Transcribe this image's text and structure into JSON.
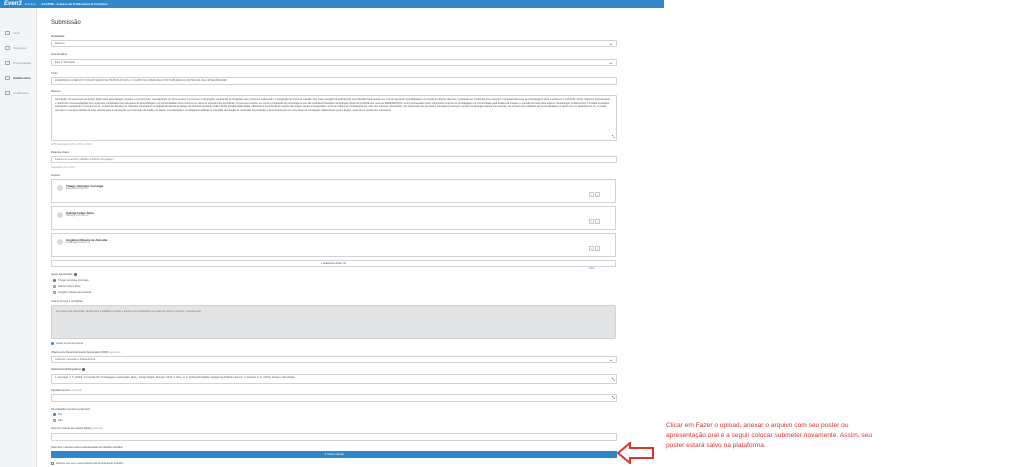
{
  "app": {
    "brand": "Even3",
    "brand_sub": "Eventos",
    "conference_title": "CLAPDE - Arquivo de Publicações & Coleções"
  },
  "sidebar": {
    "items": [
      {
        "label": "Início",
        "icon": "home-icon"
      },
      {
        "label": "Inscrições",
        "icon": "ticket-icon"
      },
      {
        "label": "Programação",
        "icon": "calendar-icon"
      },
      {
        "label": "Submissões",
        "icon": "document-icon",
        "active": true
      },
      {
        "label": "Certificados",
        "icon": "certificate-icon"
      }
    ]
  },
  "page": {
    "title": "Submissão"
  },
  "form": {
    "modality": {
      "label": "Modalidade",
      "value": "Resumo"
    },
    "thematic_area": {
      "label": "Área temática",
      "value": "Eixo 3: Educação"
    },
    "title": {
      "label": "Título",
      "value": "LIDERANÇA, EXERCITO VOLUNTÁRIOS DE TRATOS ATUAIS: O CAMPO DA LIDERANÇA POR SUPLÊNCIA E ARTIFICIAL DE A INTEGRIDADE?"
    },
    "abstract": {
      "label": "Resumo",
      "value": "Introdução: Os processos de design digital para aprendizagem ajudam a compreender, considerando um ramo crescer e promover a integração, explorando as limitações dos processos tradicionais. A integração de forma de trabalho que criam inteligência artificial (IA) na produção física dessas em ensinar ajustando possibilidades na criação de objetos diversos, resultando em melhorias que envolvem circunstancialmente de prototipagem tanto a autoria em (LATOUR, 2011). Objetivo: Confrontamos e refletimos uma investigação dos conteúdos mobilizados nas categorias de aprendizagem em funcionalidade física criamos em vídeo de experiências descritivas. O processo ocorreu em como a projetação de personagens que são ilustrados baseados na tipologia virtual do CLAPDE que reina de REDESENHOS. Como processado foram submetidos à ajuste de prototipagem na Universidade para análise da imagem e questão técnicas para objetos. Metodologia: Colaboramos o modelo da análise explorando e avaliando o processo de IA. O sistema interativo de materiais importantes na relação da autoria do design de sistemas gerativos (GEN, 2023) da fabricação digital, utilizando a ferramenta de registro da imagem dentro a integração e a forma coletiva de prototipação por meio dos suportes. Resultados: Foi observado que ela obtém constante presença e sentido na tipologia coletiva nas autorias. Os estudos nos trabalhos de funcionalidades no ajuste com os aparelhos de IA, os quais permitem o seu aprendizado da base coletiva para a construção na construção da análise de dados. Considerações: A inteligência artificial na interação da criação de conteúdos na produção e desenvolvimento em conceituar as estratégias colaborativas para o design, atuando em ambientes educativos."
    },
    "abstract_counter": "2076 palavras de 200 a 3000 de 3000",
    "keywords": {
      "label": "Palavras-chave",
      "placeholder": "Palavra de exemplo, trabalho e artifício da imagem",
      "hint": "Separadas por vírgula"
    },
    "authors": {
      "label": "Autores",
      "rows": [
        {
          "name": "Thiago Henrique Gonzaga",
          "email": "thiago@unimontes.br"
        },
        {
          "name": "Gabriel Felipe Silva",
          "email": "gabriel@unimontes.br"
        },
        {
          "name": "Angélica Oliveira de Almeida",
          "email": "angelica@unimontes.br"
        }
      ],
      "add_button": "Adicionar Autor (1)",
      "controls": {
        "up": "↑",
        "down": "↓",
        "delete": "×"
      }
    },
    "presenters": {
      "label": "Quem apresentará",
      "options": [
        {
          "label": "Thiago Henrique Gonzaga",
          "checked": true
        },
        {
          "label": "Gabriel Felipe Silva",
          "checked": false
        },
        {
          "label": "Angélica Oliveira de Almeida",
          "checked": false
        }
      ]
    },
    "terms": {
      "label": "Leia os termos e condições",
      "text": "Ao enviar esta submissão, declaro que o trabalho é inédito e autorizo sua publicação nos anais do evento conforme o regulamento.",
      "accept_label": "Aceito os termos acima"
    },
    "ods": {
      "label": "Objetivos de Desenvolvimento Sustentável (ODS)",
      "label_suffix": "(opcional)",
      "value": "Indústria, Inovação e Infraestrutura"
    },
    "references": {
      "label": "Referências Bibliográficas",
      "value": "1. Gonzaga, T. H. (2023). Impressão 3D, Prototipagem e Educação. (Eds.). Design Digital. Springer, 2023; 2. Silva, G. F. Fabricação Digital, Inteligência Artificial e Ensino; 3. Almeida, A. O. (2024). Design e Tecnologia."
    },
    "acknowledgements": {
      "label": "Agradecimentos",
      "label_suffix": "(opcional)"
    },
    "award_question": {
      "label": "Seu trabalho concorre a prêmios?",
      "options": [
        {
          "label": "Sim",
          "checked": true
        },
        {
          "label": "Não",
          "checked": false
        }
      ]
    },
    "poster_link": {
      "label": "Informe o link do seu pôster digital",
      "label_suffix": "(opcional)"
    },
    "upload_section_label": "Submeter o arquivo para a apresentação do trabalho científico",
    "upload_button": "Fazer upload",
    "declaration": "Declaro que sou o responsável pela autoria deste trabalho"
  },
  "annotation": {
    "text": "Clicar em Fazer o upload, anexar o arquivo com seu poster ou apresentação oral e a seguir colocar submeter novamente. Assim, seu poster estará salvo na plataforma.",
    "color": "#e0312b"
  },
  "colors": {
    "accent": "#2f86c9",
    "annotation": "#e0312b"
  }
}
